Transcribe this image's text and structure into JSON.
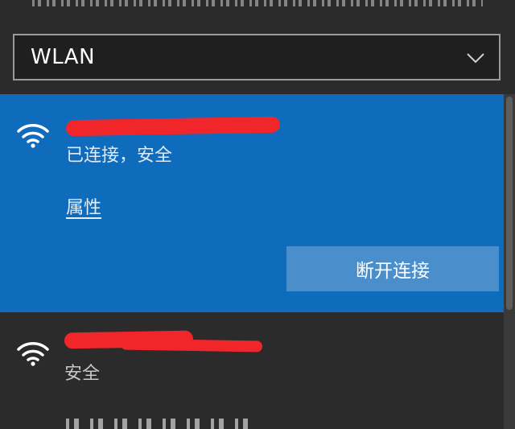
{
  "adapter": {
    "selected": "WLAN"
  },
  "networks": [
    {
      "ssid": "",
      "status": "已连接，安全",
      "properties_link": "属性",
      "action_button": "断开连接",
      "icon": "wifi-signal-icon"
    },
    {
      "ssid": "",
      "status": "安全",
      "icon": "wifi-signal-icon"
    }
  ],
  "colors": {
    "panel_bg": "#2b2b2b",
    "selected_bg": "#0f6cbd",
    "button_bg": "#4a8fcc",
    "redaction": "#f0262a"
  }
}
